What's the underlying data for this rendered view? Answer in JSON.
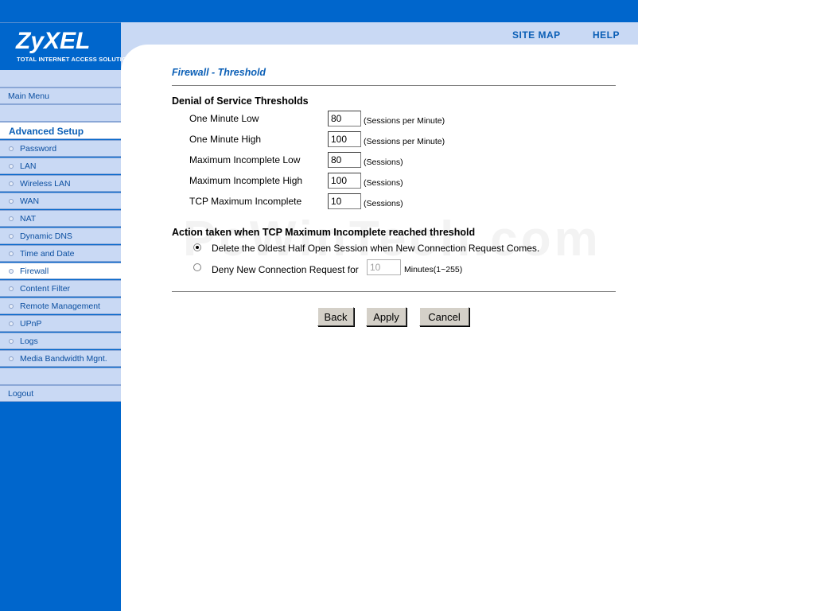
{
  "header": {
    "logo_brand": "ZyXEL",
    "logo_tagline": "TOTAL INTERNET ACCESS SOLUTION",
    "site_map": "SITE MAP",
    "help": "HELP"
  },
  "sidebar": {
    "main_menu": "Main Menu",
    "advanced_setup": "Advanced Setup",
    "items": [
      {
        "label": "Password"
      },
      {
        "label": "LAN"
      },
      {
        "label": "Wireless LAN"
      },
      {
        "label": "WAN"
      },
      {
        "label": "NAT"
      },
      {
        "label": "Dynamic DNS"
      },
      {
        "label": "Time and Date"
      },
      {
        "label": "Firewall"
      },
      {
        "label": "Content Filter"
      },
      {
        "label": "Remote Management"
      },
      {
        "label": "UPnP"
      },
      {
        "label": "Logs"
      },
      {
        "label": "Media Bandwidth Mgnt."
      }
    ],
    "active_item": "Firewall",
    "logout": "Logout"
  },
  "page": {
    "title": "Firewall - Threshold",
    "dos_section": "Denial of Service Thresholds",
    "thresholds": [
      {
        "label": "One Minute Low",
        "value": "80",
        "unit": "(Sessions per Minute)"
      },
      {
        "label": "One Minute High",
        "value": "100",
        "unit": "(Sessions per Minute)"
      },
      {
        "label": "Maximum Incomplete Low",
        "value": "80",
        "unit": "(Sessions)"
      },
      {
        "label": "Maximum Incomplete High",
        "value": "100",
        "unit": "(Sessions)"
      },
      {
        "label": "TCP Maximum Incomplete",
        "value": "10",
        "unit": "(Sessions)"
      }
    ],
    "action_section": "Action taken when TCP Maximum Incomplete reached threshold",
    "option_delete": "Delete the Oldest Half Open Session when New Connection Request Comes.",
    "option_deny": "Deny New Connection Request for",
    "deny_minutes_value": "10",
    "minutes_unit": "Minutes(1~255)",
    "selected_option": "delete",
    "buttons": {
      "back": "Back",
      "apply": "Apply",
      "cancel": "Cancel"
    }
  },
  "watermark": "PcWinTech.com",
  "colors": {
    "brand_blue": "#0066cc",
    "menu_light": "#c9d9f4",
    "link_blue": "#0b5fb6"
  }
}
